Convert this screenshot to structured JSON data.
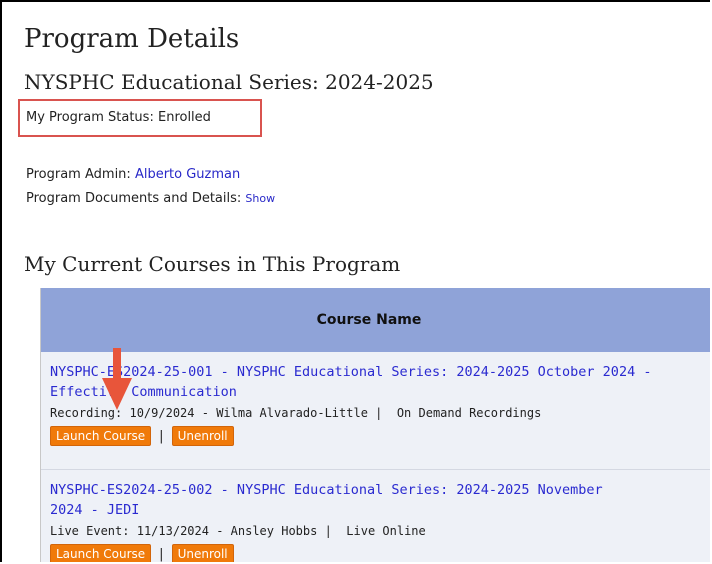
{
  "page": {
    "title": "Program Details",
    "subtitle": "NYSPHC Educational Series: 2024-2025",
    "status_label": "My Program Status:",
    "status_value": "Enrolled",
    "admin_label": "Program Admin:",
    "admin_name": "Alberto Guzman",
    "docs_label": "Program Documents and Details:",
    "docs_link": "Show",
    "section_title": "My Current Courses in This Program"
  },
  "table": {
    "header": "Course Name",
    "rows": [
      {
        "course_line1": "NYSPHC-ES2024-25-001 - NYSPHC Educational Series: 2024-2025 October 2024 -",
        "course_line2": "Effective Communication",
        "type": "Recording:",
        "date": "10/9/2024",
        "presenter": "Wilma Alvarado-Little",
        "delivery": "On Demand Recordings",
        "launch_label": "Launch Course",
        "unenroll_label": "Unenroll",
        "separator": "|"
      },
      {
        "course_line1": "NYSPHC-ES2024-25-002 - NYSPHC Educational Series: 2024-2025 November",
        "course_line2": "2024 - JEDI",
        "type": "Live Event:",
        "date": "11/13/2024",
        "presenter": "Ansley Hobbs",
        "delivery": "Live Online",
        "launch_label": "Launch Course",
        "unenroll_label": "Unenroll",
        "separator": "|"
      }
    ]
  },
  "colors": {
    "highlight_box": "#d9534f",
    "arrow": "#e8553a",
    "button": "#f07a0a",
    "table_header": "#8fa3d8",
    "link": "#2828c8"
  },
  "icons": {
    "annotation": "down-arrow-icon"
  }
}
